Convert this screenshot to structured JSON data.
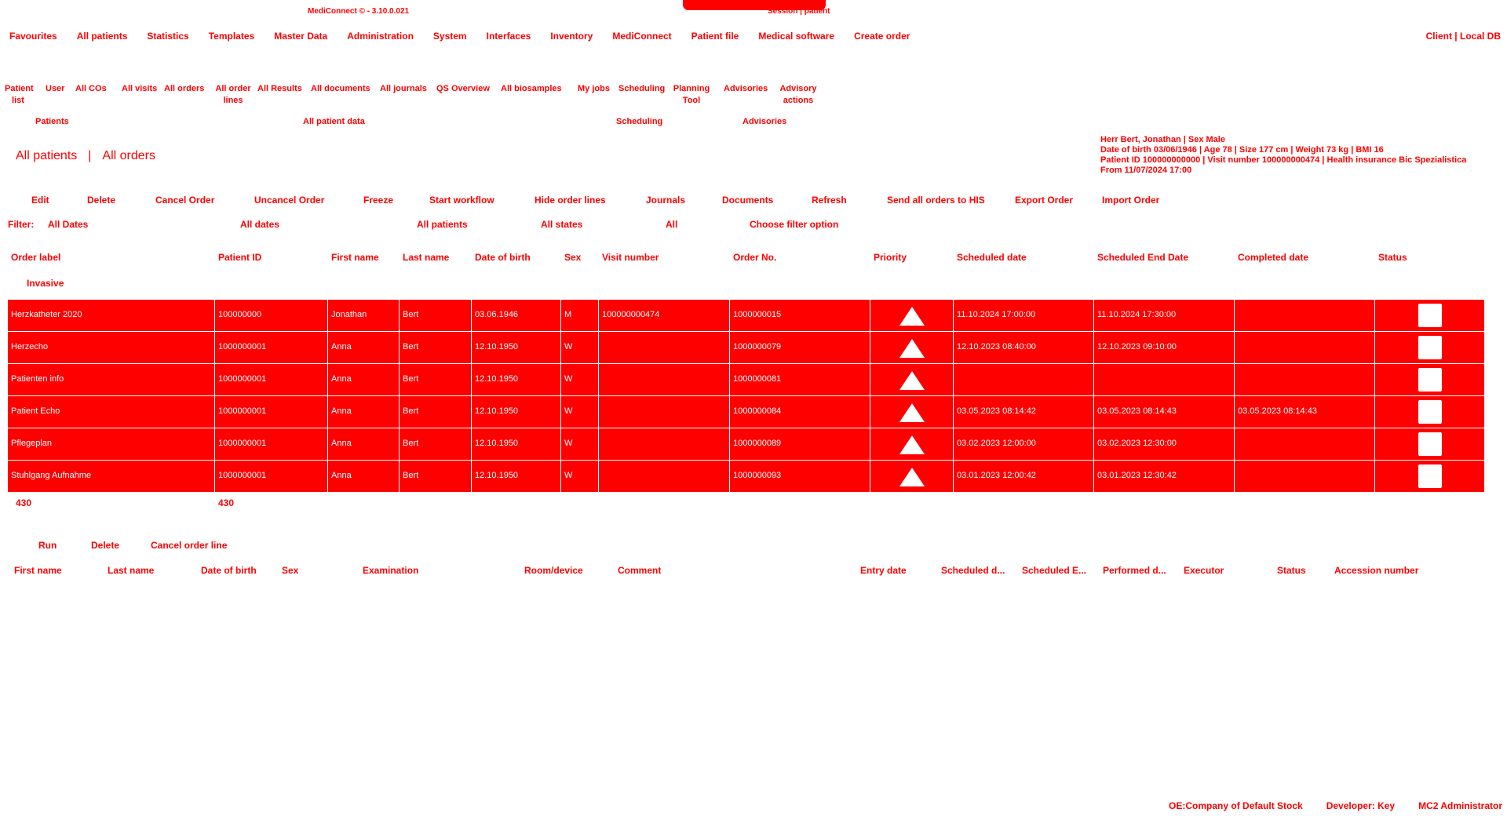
{
  "app": {
    "title": "MediConnect © - 3.10.0.021",
    "session": "Session | patient"
  },
  "main_menu": [
    "Favourites",
    "All patients",
    "Statistics",
    "Templates",
    "Master Data",
    "Administration",
    "System",
    "Interfaces",
    "Inventory",
    "MediConnect",
    "Patient file",
    "Medical software",
    "Create order"
  ],
  "client_info": "Client | Local DB",
  "ribbon": {
    "items": [
      "Patient list",
      "User",
      "All COs",
      "All visits",
      "All orders",
      "All order lines",
      "All Results",
      "All documents",
      "All journals",
      "QS Overview",
      "All biosamples",
      "My jobs",
      "Scheduling",
      "Planning Tool",
      "Advisories",
      "Advisory actions"
    ],
    "groups": [
      "Patients",
      "All patient data",
      "Scheduling",
      "Advisories"
    ]
  },
  "breadcrumb": {
    "part1": "All patients",
    "separator": "|",
    "part2": "All orders"
  },
  "patient": {
    "line1": "Herr Bert, Jonathan | Sex Male",
    "line2": "Date of birth 03/06/1946 | Age 78 | Size 177 cm | Weight 73 kg | BMI 16",
    "line3": "Patient ID 100000000000 | Visit number 100000000474 | Health insurance Bic Spezialistica",
    "line4": "From 11/07/2024 17:00"
  },
  "toolbar": [
    "Edit",
    "Delete",
    "Cancel Order",
    "Uncancel Order",
    "Freeze",
    "Start workflow",
    "Hide order lines",
    "Journals",
    "Documents",
    "Refresh",
    "Send all orders to HIS",
    "Export Order",
    "Import Order"
  ],
  "filters": {
    "label": "Filter:",
    "dates_label": "All Dates",
    "dates": "All dates",
    "patients": "All patients",
    "states": "All states",
    "all": "All",
    "option": "Choose filter option"
  },
  "orders_table": {
    "columns": [
      "Order label",
      "Patient ID",
      "First name",
      "Last name",
      "Date of birth",
      "Sex",
      "Visit number",
      "Order No.",
      "Priority",
      "Scheduled date",
      "Scheduled End Date",
      "Completed date",
      "Status"
    ],
    "group_label": "Invasive",
    "rows": [
      {
        "label": "Herzkatheter 2020",
        "patient_id": "100000000",
        "first": "Jonathan",
        "last": "Bert",
        "dob": "03.06.1946",
        "sex": "M",
        "visit": "100000000474",
        "order_no": "1000000015",
        "priority": "high",
        "sched": "11.10.2024 17:00:00",
        "sched_end": "11.10.2024 17:30:00",
        "completed": "",
        "status": "open"
      },
      {
        "label": "Herzecho",
        "patient_id": "1000000001",
        "first": "Anna",
        "last": "Bert",
        "dob": "12.10.1950",
        "sex": "W",
        "visit": "",
        "order_no": "1000000079",
        "priority": "high",
        "sched": "12.10.2023 08:40:00",
        "sched_end": "12.10.2023 09:10:00",
        "completed": "",
        "status": "open"
      },
      {
        "label": "Patienten info",
        "patient_id": "1000000001",
        "first": "Anna",
        "last": "Bert",
        "dob": "12.10.1950",
        "sex": "W",
        "visit": "",
        "order_no": "1000000081",
        "priority": "high",
        "sched": "",
        "sched_end": "",
        "completed": "",
        "status": "open"
      },
      {
        "label": "Patient Echo",
        "patient_id": "1000000001",
        "first": "Anna",
        "last": "Bert",
        "dob": "12.10.1950",
        "sex": "W",
        "visit": "",
        "order_no": "1000000084",
        "priority": "high",
        "sched": "03.05.2023 08:14:42",
        "sched_end": "03.05.2023 08:14:43",
        "completed": "03.05.2023 08:14:43",
        "status": "open"
      },
      {
        "label": "Pflegeplan",
        "patient_id": "1000000001",
        "first": "Anna",
        "last": "Bert",
        "dob": "12.10.1950",
        "sex": "W",
        "visit": "",
        "order_no": "1000000089",
        "priority": "high",
        "sched": "03.02.2023 12:00:00",
        "sched_end": "03.02.2023 12:30:00",
        "completed": "",
        "status": "open"
      },
      {
        "label": "Stuhlgang Aufnahme",
        "patient_id": "1000000001",
        "first": "Anna",
        "last": "Bert",
        "dob": "12.10.1950",
        "sex": "W",
        "visit": "",
        "order_no": "1000000093",
        "priority": "high",
        "sched": "03.01.2023 12:00:42",
        "sched_end": "03.01.2023 12:30:42",
        "completed": "",
        "status": "open"
      }
    ],
    "count_left": "430",
    "count_right": "430"
  },
  "order_lines": {
    "toolbar": [
      "Run",
      "Delete",
      "Cancel order line"
    ],
    "columns": [
      "First name",
      "Last name",
      "Date of birth",
      "Sex",
      "Examination",
      "Room/device",
      "Comment",
      "Entry date",
      "Scheduled d...",
      "Scheduled E...",
      "Performed d...",
      "Executor",
      "Status",
      "Accession number"
    ]
  },
  "statusbar": [
    "OE:Company of Default Stock",
    "Developer: Key",
    "MC2 Administrator"
  ],
  "colors": {
    "accent": "#ff0000",
    "text_on_accent": "#ffffff"
  }
}
